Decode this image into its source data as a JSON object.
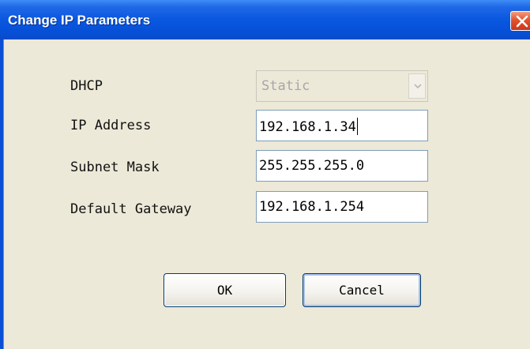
{
  "window": {
    "title": "Change IP Parameters",
    "close_icon": "close-icon"
  },
  "form": {
    "dhcp_label": "DHCP",
    "dhcp_value": "Static",
    "ip_label": "IP Address",
    "ip_value": "192.168.1.34",
    "subnet_label": "Subnet Mask",
    "subnet_value": "255.255.255.0",
    "gateway_label": "Default Gateway",
    "gateway_value": "192.168.1.254"
  },
  "buttons": {
    "ok_label": "OK",
    "cancel_label": "Cancel"
  },
  "colors": {
    "titlebar": "#0a58e0",
    "dialog_background": "#ece9d8",
    "field_border": "#7f9db9",
    "disabled_text": "#a7a6aa"
  }
}
